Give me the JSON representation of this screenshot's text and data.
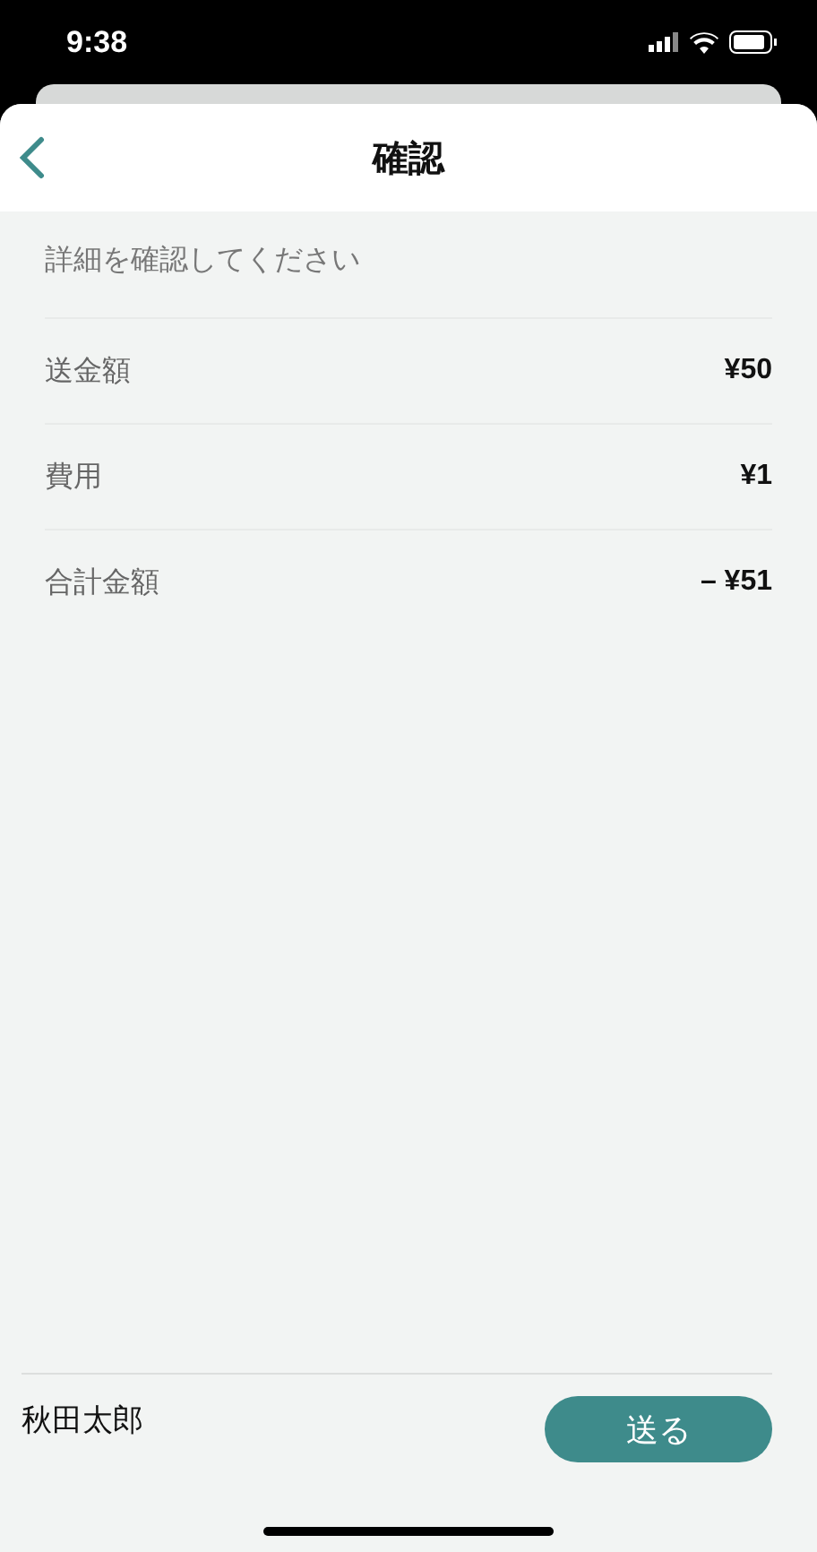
{
  "status_bar": {
    "time": "9:38"
  },
  "header": {
    "title": "確認"
  },
  "instruction": "詳細を確認してください",
  "rows": [
    {
      "label": "送金額",
      "value": "¥50"
    },
    {
      "label": "費用",
      "value": "¥1"
    },
    {
      "label": "合計金額",
      "value": "– ¥51"
    }
  ],
  "footer": {
    "name": "秋田太郎",
    "button": "送る"
  }
}
